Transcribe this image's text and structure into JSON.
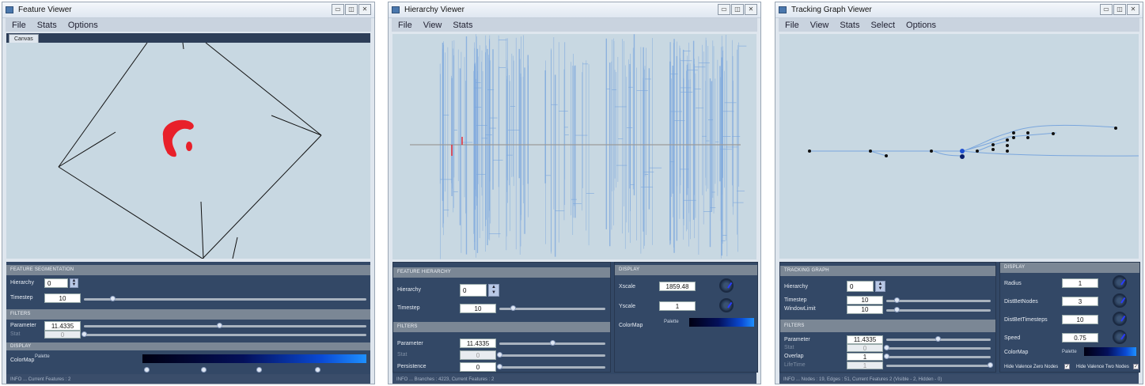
{
  "windows": {
    "feature": {
      "title": "Feature Viewer",
      "menu": [
        "File",
        "Stats",
        "Options"
      ],
      "tab_label": "Canvas",
      "seg_header": "FEATURE SEGMENTATION",
      "hierarchy_label": "Hierarchy",
      "hierarchy_value": "0",
      "timestep_label": "Timestep",
      "timestep_value": "10",
      "filters_header": "FILTERS",
      "parameter_label": "Parameter",
      "parameter_value": "11.4335",
      "stat_label": "Stat",
      "stat_value": "0",
      "display_header": "DISPLAY",
      "colormap_label": "ColorMap",
      "palette_label": "Palette",
      "info": "INFO ...   Current Features : 2"
    },
    "hierarchy": {
      "title": "Hierarchy Viewer",
      "menu": [
        "File",
        "View",
        "Stats"
      ],
      "fh_header": "FEATURE HIERARCHY",
      "hierarchy_label": "Hierarchy",
      "hierarchy_value": "0",
      "timestep_label": "Timestep",
      "timestep_value": "10",
      "filters_header": "FILTERS",
      "parameter_label": "Parameter",
      "parameter_value": "11.4335",
      "stat_label": "Stat",
      "stat_value": "0",
      "persistence_label": "Persistence",
      "persistence_value": "0",
      "display_header": "DISPLAY",
      "xscale_label": "Xscale",
      "xscale_value": "1859.48",
      "yscale_label": "Yscale",
      "yscale_value": "1",
      "colormap_label": "ColorMap",
      "palette_label": "Palette",
      "info": "INFO ...   Branches : 4223, Current Features : 2"
    },
    "tracking": {
      "title": "Tracking Graph Viewer",
      "menu": [
        "File",
        "View",
        "Stats",
        "Select",
        "Options"
      ],
      "tg_header": "TRACKING GRAPH",
      "hierarchy_label": "Hierarchy",
      "hierarchy_value": "0",
      "timestep_label": "Timestep",
      "timestep_value": "10",
      "windowlimit_label": "WindowLimit",
      "windowlimit_value": "10",
      "filters_header": "FILTERS",
      "parameter_label": "Parameter",
      "parameter_value": "11.4335",
      "stat_label": "Stat",
      "stat_value": "0",
      "overlap_label": "Overlap",
      "overlap_value": "1",
      "lifetime_label": "LifeTime",
      "lifetime_value": "1",
      "display_header": "DISPLAY",
      "radius_label": "Radius",
      "radius_value": "1",
      "distbetnodes_label": "DistBetNodes",
      "distbetnodes_value": "3",
      "distbettimesteps_label": "DistBetTimesteps",
      "distbettimesteps_value": "10",
      "speed_label": "Speed",
      "speed_value": "0.75",
      "colormap_label": "ColorMap",
      "palette_label": "Palette",
      "hide_zero_label": "Hide Valence Zero Nodes",
      "hide_two_label": "Hide Valence Two Nodes",
      "info": "INFO ...   Nodes : 19, Edges : 51, Current Features 2 (Visible - 2, Hidden - 0)"
    }
  },
  "colors": {
    "canvas_bg": "#c8d8e2",
    "panel_bg": "#334866",
    "feature_red": "#e8202a",
    "branch_blue": "#7aa6dd",
    "node_dark": "#111111",
    "node_blue": "#1f4fd0"
  },
  "window_icons": [
    "minimize-icon",
    "maximize-icon",
    "close-icon"
  ]
}
